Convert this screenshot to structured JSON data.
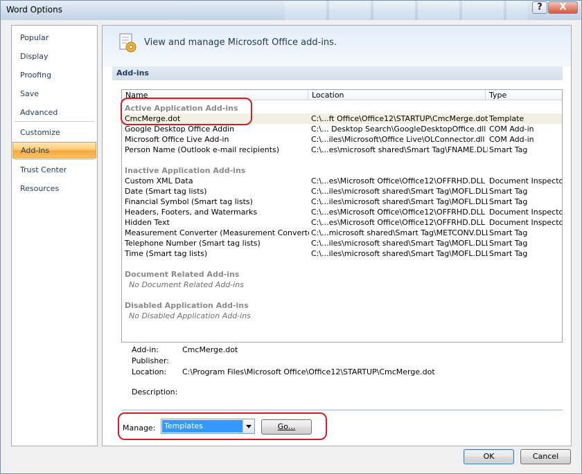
{
  "window": {
    "title": "Word Options"
  },
  "titlebar": {
    "help_label": "?",
    "close_label": "X"
  },
  "nav": {
    "items": [
      {
        "label": "Popular"
      },
      {
        "label": "Display"
      },
      {
        "label": "Proofing"
      },
      {
        "label": "Save"
      },
      {
        "label": "Advanced"
      },
      {
        "label": "Customize"
      },
      {
        "label": "Add-Ins",
        "selected": true
      },
      {
        "label": "Trust Center"
      },
      {
        "label": "Resources"
      }
    ]
  },
  "header": {
    "text": "View and manage Microsoft Office add-ins."
  },
  "section": {
    "title": "Add-ins"
  },
  "list": {
    "columns": [
      "Name",
      "Location",
      "Type"
    ],
    "groups": {
      "active": {
        "title": "Active Application Add-ins",
        "rows": [
          {
            "name": "CmcMerge.dot",
            "location": "C:\\...ft Office\\Office12\\STARTUP\\CmcMerge.dot",
            "type": "Template"
          },
          {
            "name": "Google Desktop Office Addin",
            "location": "C:\\... Desktop Search\\GoogleDesktopOffice.dll",
            "type": "COM Add-in"
          },
          {
            "name": "Microsoft Office Live Add-in",
            "location": "C:\\...iles\\Microsoft\\Office Live\\OLConnector.dll",
            "type": "COM Add-in"
          },
          {
            "name": "Person Name (Outlook e-mail recipients)",
            "location": "C:\\...es\\microsoft shared\\Smart Tag\\FNAME.DLL",
            "type": "Smart Tag"
          }
        ]
      },
      "inactive": {
        "title": "Inactive Application Add-ins",
        "rows": [
          {
            "name": "Custom XML Data",
            "location": "C:\\...es\\Microsoft Office\\Office12\\OFFRHD.DLL",
            "type": "Document Inspector"
          },
          {
            "name": "Date (Smart tag lists)",
            "location": "C:\\...iles\\microsoft shared\\Smart Tag\\MOFL.DLL",
            "type": "Smart Tag"
          },
          {
            "name": "Financial Symbol (Smart tag lists)",
            "location": "C:\\...iles\\microsoft shared\\Smart Tag\\MOFL.DLL",
            "type": "Smart Tag"
          },
          {
            "name": "Headers, Footers, and Watermarks",
            "location": "C:\\...es\\Microsoft Office\\Office12\\OFFRHD.DLL",
            "type": "Document Inspector"
          },
          {
            "name": "Hidden Text",
            "location": "C:\\...es\\Microsoft Office\\Office12\\OFFRHD.DLL",
            "type": "Document Inspector"
          },
          {
            "name": "Measurement Converter (Measurement Converter)",
            "location": "C:\\...microsoft shared\\Smart Tag\\METCONV.DLL",
            "type": "Smart Tag"
          },
          {
            "name": "Telephone Number (Smart tag lists)",
            "location": "C:\\...iles\\microsoft shared\\Smart Tag\\MOFL.DLL",
            "type": "Smart Tag"
          },
          {
            "name": "Time (Smart tag lists)",
            "location": "C:\\...iles\\microsoft shared\\Smart Tag\\MOFL.DLL",
            "type": "Smart Tag"
          }
        ]
      },
      "document": {
        "title": "Document Related Add-ins",
        "empty": "No Document Related Add-ins"
      },
      "disabled": {
        "title": "Disabled Application Add-ins",
        "empty": "No Disabled Application Add-ins"
      }
    }
  },
  "details": {
    "addin_label": "Add-in:",
    "addin_value": "CmcMerge.dot",
    "publisher_label": "Publisher:",
    "publisher_value": "",
    "location_label": "Location:",
    "location_value": "C:\\Program Files\\Microsoft Office\\Office12\\STARTUP\\CmcMerge.dot",
    "description_label": "Description:",
    "description_value": ""
  },
  "manage": {
    "label": "Manage:",
    "selected": "Templates",
    "go_label": "Go..."
  },
  "footer": {
    "ok_label": "OK",
    "cancel_label": "Cancel"
  },
  "colors": {
    "selection_orange": "#f7a63a",
    "annotation_red": "#d31c28",
    "dropdown_blue": "#3399ff"
  }
}
